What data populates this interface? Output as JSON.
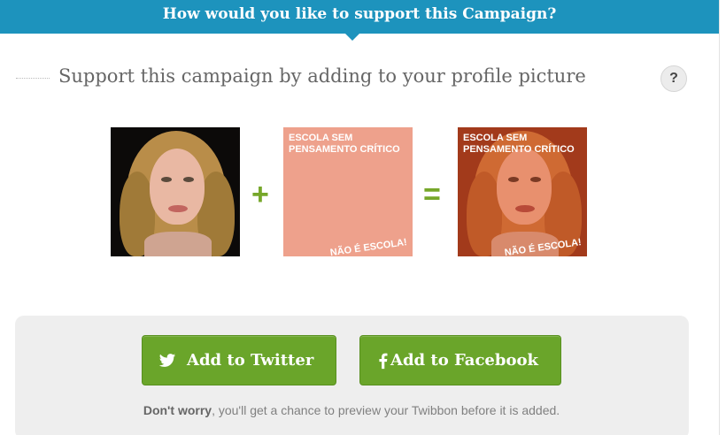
{
  "header": {
    "title": "How would you like to support this Campaign?"
  },
  "subtitle": {
    "text": "Support this campaign by adding to your profile picture",
    "help": "?"
  },
  "overlay": {
    "top_text": "ESCOLA SEM PENSAMENTO CRÍTICO",
    "bottom_text": "NÃO É ESCOLA!"
  },
  "operators": {
    "plus": "+",
    "equals": "="
  },
  "actions": {
    "twitter_label": "Add to Twitter",
    "facebook_label": "Add to Facebook"
  },
  "note": {
    "emphasis": "Don't worry",
    "rest": ", you'll get a chance to preview your Twibbon before it is added."
  },
  "colors": {
    "header_bg": "#1d93bd",
    "button_green": "#6aa52a",
    "operator_green": "#76a72a",
    "overlay_salmon": "#eea18c"
  },
  "icons": {
    "help": "question-icon",
    "twitter": "twitter-bird-icon",
    "facebook": "facebook-f-icon"
  }
}
